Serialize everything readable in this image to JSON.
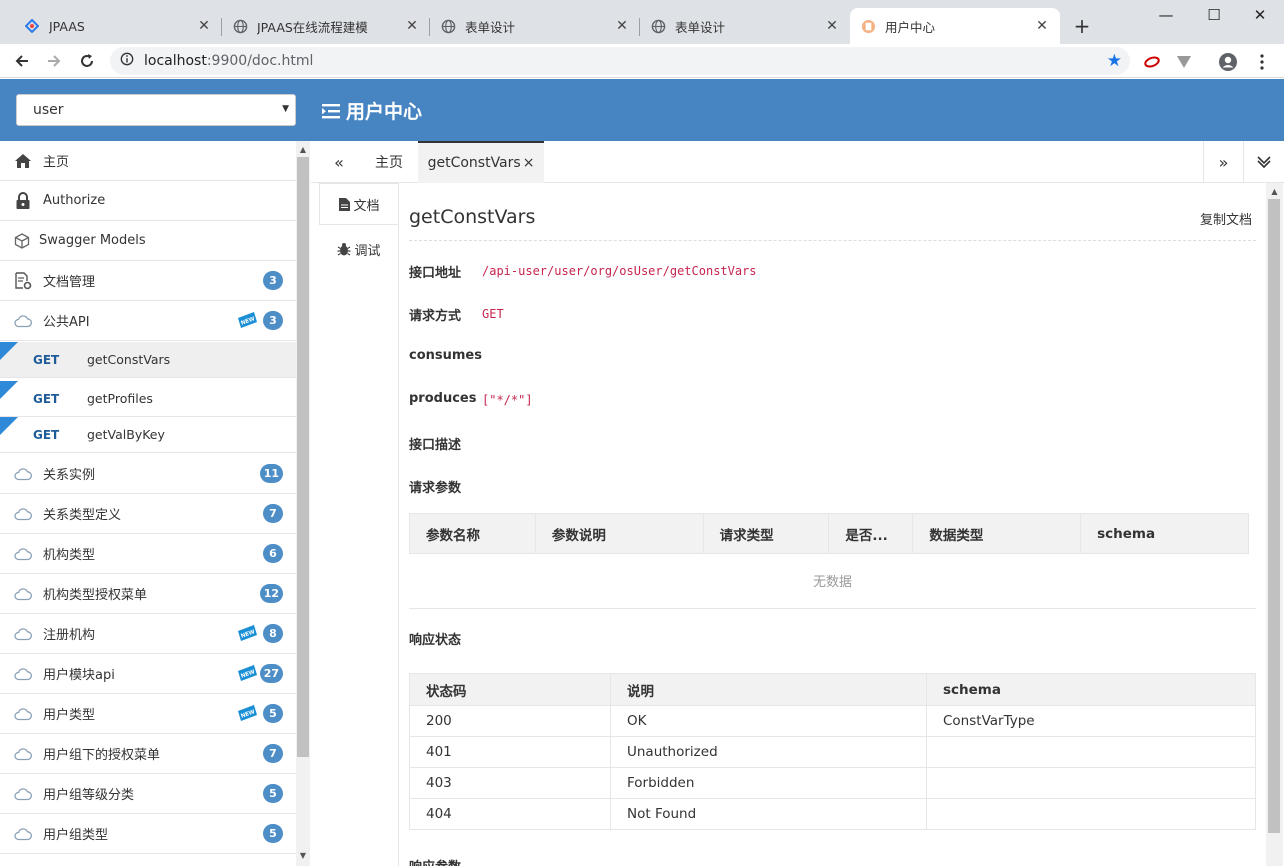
{
  "browser": {
    "tabs": [
      {
        "title": "JPAAS",
        "icon": "jpaas-logo-icon"
      },
      {
        "title": "JPAAS在线流程建模",
        "icon": "globe-icon"
      },
      {
        "title": "表单设计",
        "icon": "globe-icon"
      },
      {
        "title": "表单设计",
        "icon": "globe-icon"
      },
      {
        "title": "用户中心",
        "icon": "document-icon"
      }
    ],
    "address": {
      "host": "localhost",
      "rest": ":9900/doc.html"
    }
  },
  "header": {
    "group_select": "user",
    "title": "用户中心"
  },
  "sidebar": {
    "items": [
      {
        "label": "主页",
        "icon": "home-icon"
      },
      {
        "label": "Authorize",
        "icon": "lock-icon"
      },
      {
        "label": "Swagger Models",
        "icon": "model-icon"
      },
      {
        "label": "文档管理",
        "icon": "doc-settings-icon",
        "badge": "3"
      },
      {
        "label": "公共API",
        "icon": "cloud-api-icon",
        "badge": "3",
        "new": true
      },
      {
        "label": "关系实例",
        "icon": "cloud-api-icon",
        "badge": "11"
      },
      {
        "label": "关系类型定义",
        "icon": "cloud-api-icon",
        "badge": "7"
      },
      {
        "label": "机构类型",
        "icon": "cloud-api-icon",
        "badge": "6"
      },
      {
        "label": "机构类型授权菜单",
        "icon": "cloud-api-icon",
        "badge": "12"
      },
      {
        "label": "注册机构",
        "icon": "cloud-api-icon",
        "badge": "8",
        "new": true
      },
      {
        "label": "用户模块api",
        "icon": "cloud-api-icon",
        "badge": "27",
        "new": true
      },
      {
        "label": "用户类型",
        "icon": "cloud-api-icon",
        "badge": "5",
        "new": true
      },
      {
        "label": "用户组下的授权菜单",
        "icon": "cloud-api-icon",
        "badge": "7"
      },
      {
        "label": "用户组等级分类",
        "icon": "cloud-api-icon",
        "badge": "5"
      },
      {
        "label": "用户组类型",
        "icon": "cloud-api-icon",
        "badge": "5"
      }
    ],
    "sub_items": [
      {
        "method": "GET",
        "path": "getConstVars"
      },
      {
        "method": "GET",
        "path": "getProfiles"
      },
      {
        "method": "GET",
        "path": "getValByKey"
      }
    ],
    "new_label": "NEW"
  },
  "content_tabs": {
    "home": "主页",
    "active": "getConstVars",
    "close": "×"
  },
  "side_tabs": {
    "doc": "文档",
    "debug": "调试"
  },
  "doc": {
    "title": "getConstVars",
    "copy": "复制文档",
    "url_label": "接口地址",
    "url": "/api-user/user/org/osUser/getConstVars",
    "method_label": "请求方式",
    "method": "GET",
    "consumes_label": "consumes",
    "produces_label": "produces",
    "produces": "[\"*/*\"]",
    "desc_label": "接口描述",
    "params_label": "请求参数",
    "params_headers": [
      "参数名称",
      "参数说明",
      "请求类型",
      "是否...",
      "数据类型",
      "schema"
    ],
    "no_data": "无数据",
    "resp_status_label": "响应状态",
    "resp_headers": [
      "状态码",
      "说明",
      "schema"
    ],
    "resp_rows": [
      [
        "200",
        "OK",
        "ConstVarType"
      ],
      [
        "401",
        "Unauthorized",
        ""
      ],
      [
        "403",
        "Forbidden",
        ""
      ],
      [
        "404",
        "Not Found",
        ""
      ]
    ],
    "resp_params_label": "响应参数"
  }
}
